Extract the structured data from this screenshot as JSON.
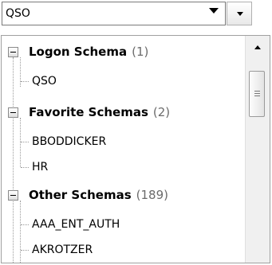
{
  "schema_selector": {
    "value": "QSO"
  },
  "tree": {
    "groups": [
      {
        "label": "Logon Schema",
        "count": "(1)",
        "items": [
          "QSO"
        ]
      },
      {
        "label": "Favorite Schemas",
        "count": "(2)",
        "items": [
          "BBODDICKER",
          "HR"
        ]
      },
      {
        "label": "Other Schemas",
        "count": "(189)",
        "items": [
          "AAA_ENT_AUTH",
          "AKROTZER"
        ]
      }
    ]
  },
  "icons": {
    "dropdown": "chevron-down-icon",
    "expander": "collapse-minus-icon",
    "scroll_up": "arrow-up-icon"
  },
  "colors": {
    "count_text": "#6b6b6b",
    "tree_lines": "#9a9a9a"
  }
}
